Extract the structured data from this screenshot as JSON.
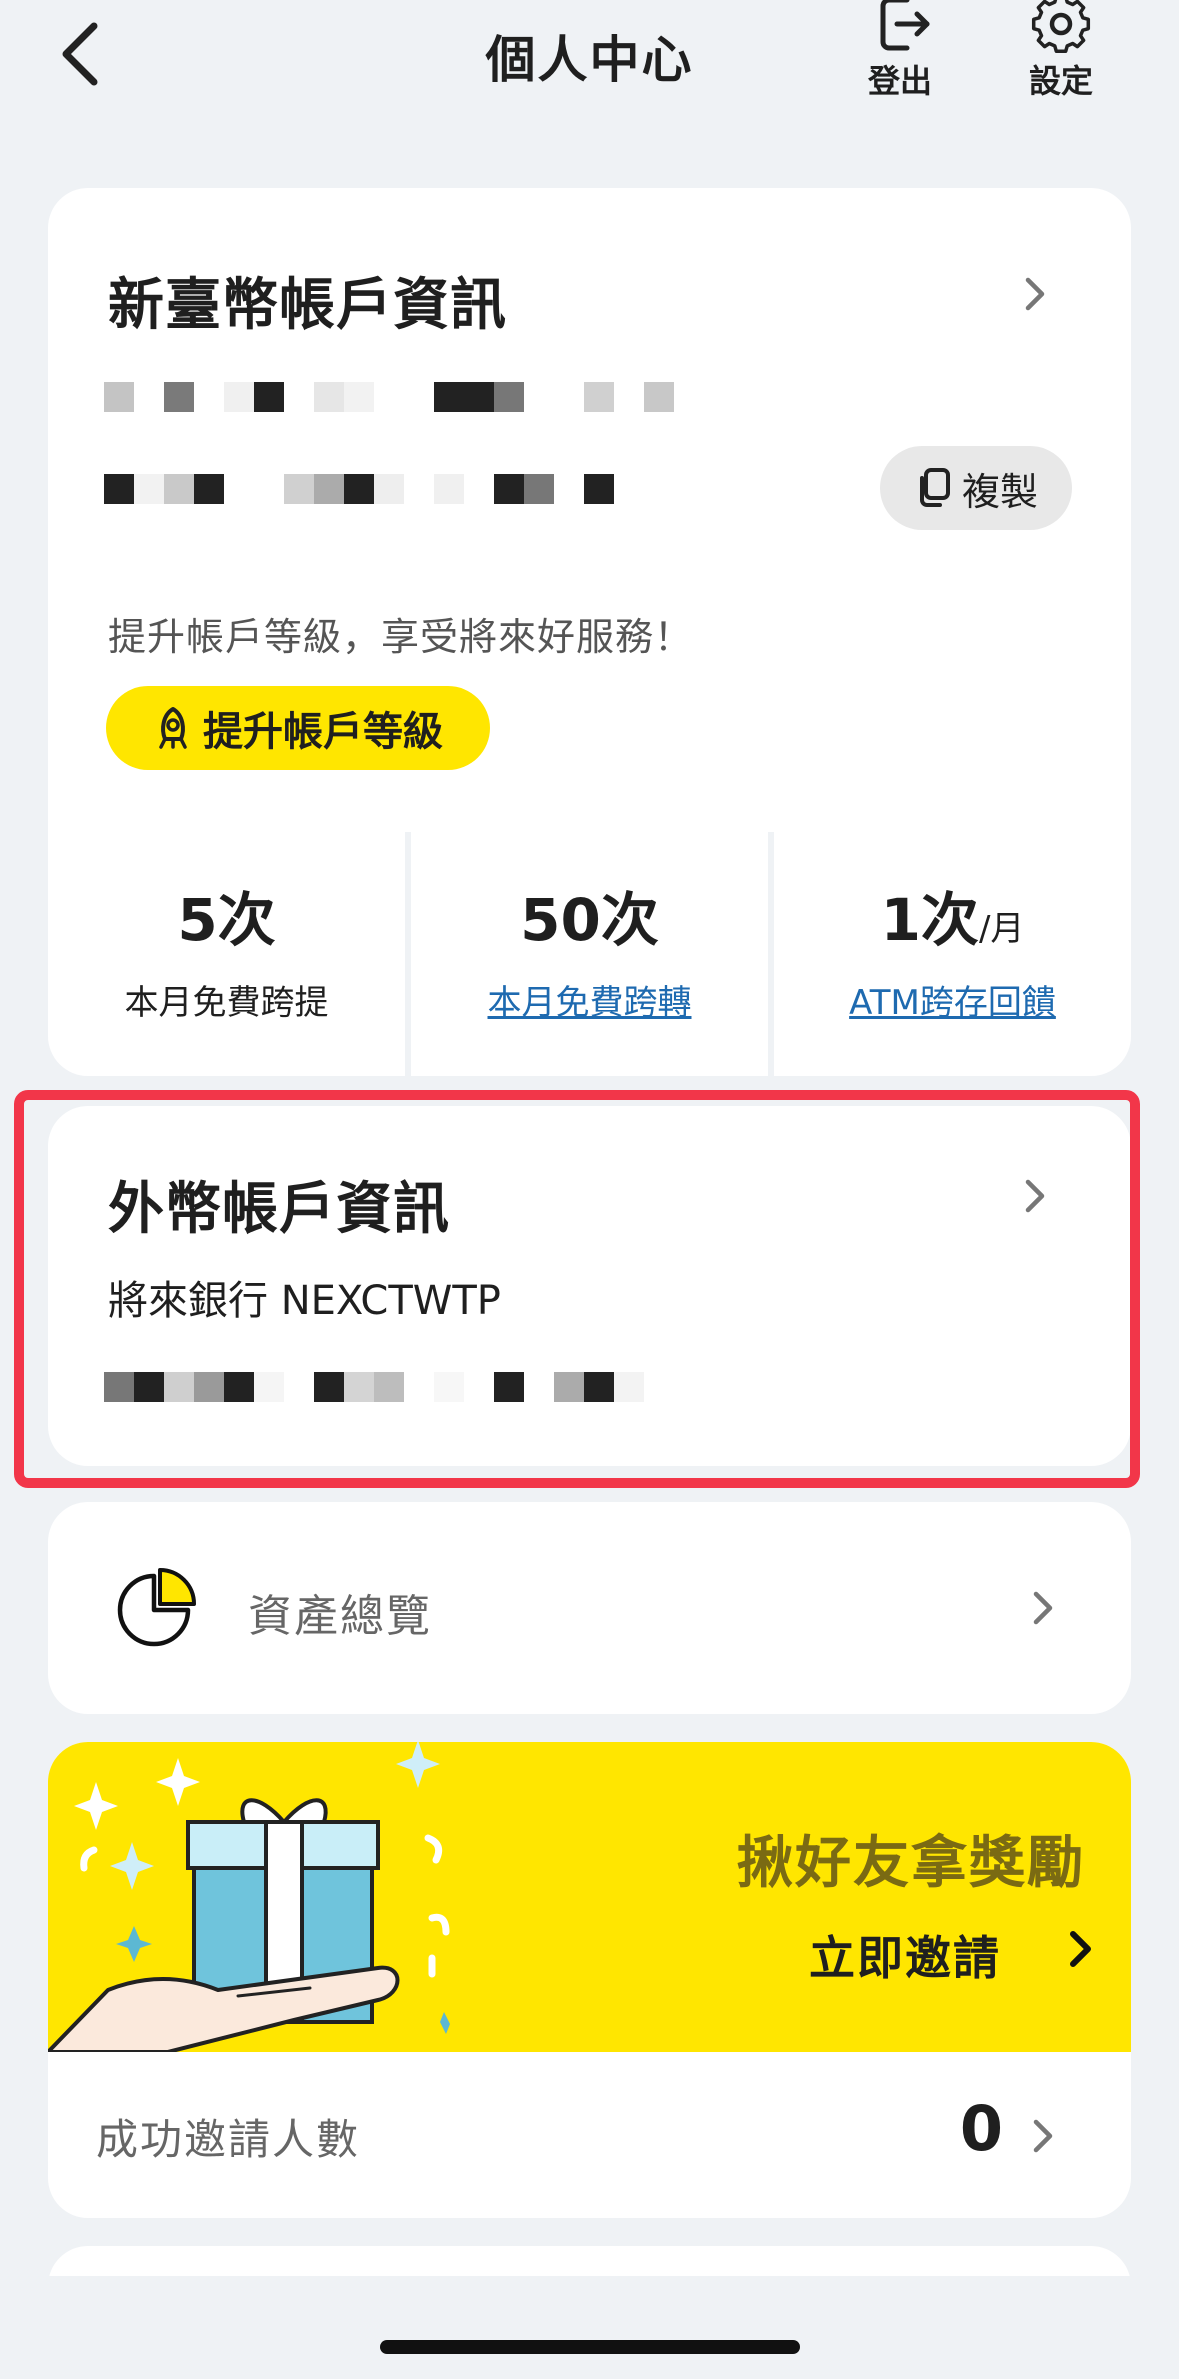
{
  "header": {
    "title": "個人中心",
    "logout_label": "登出",
    "settings_label": "設定"
  },
  "twd_account": {
    "title": "新臺幣帳戶資訊",
    "copy_label": "複製",
    "upgrade_hint": "提升帳戶等級，享受將來好服務！",
    "upgrade_button": "提升帳戶等級"
  },
  "stats": [
    {
      "value": "5次",
      "unit": "",
      "label": "本月免費跨提",
      "is_link": false
    },
    {
      "value": "50次",
      "unit": "",
      "label": "本月免費跨轉",
      "is_link": true
    },
    {
      "value": "1次",
      "unit": "/月",
      "label": "ATM跨存回饋",
      "is_link": true
    }
  ],
  "fx_account": {
    "title": "外幣帳戶資訊",
    "bank": "將來銀行 NEXCTWTP"
  },
  "asset": {
    "label": "資產總覽"
  },
  "referral": {
    "title": "揪好友拿獎勵",
    "cta": "立即邀請",
    "row_label": "成功邀請人數",
    "count": "0"
  },
  "colors": {
    "accent_yellow": "#ffe600",
    "highlight_red": "#f23649",
    "link_blue": "#1e6ab0",
    "background": "#eff2f5"
  }
}
